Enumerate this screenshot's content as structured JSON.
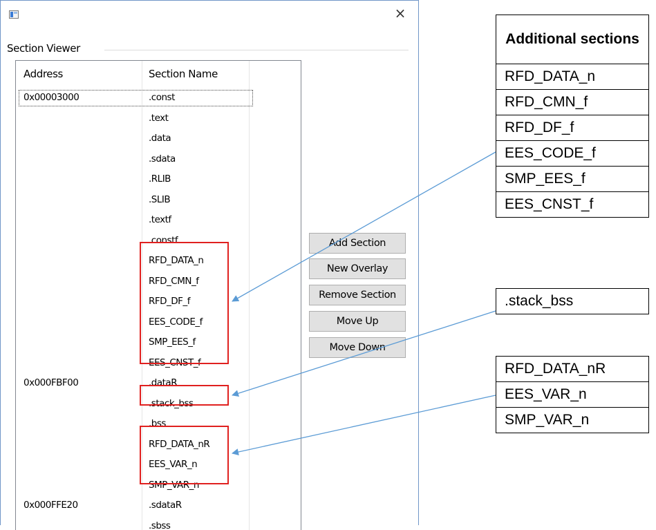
{
  "window": {
    "close_glyph": "×",
    "group_label": "Section Viewer"
  },
  "list": {
    "columns": [
      "Address",
      "Section Name"
    ],
    "rows": [
      {
        "address": "0x00003000",
        "name": ".const"
      },
      {
        "address": "",
        "name": ".text"
      },
      {
        "address": "",
        "name": ".data"
      },
      {
        "address": "",
        "name": ".sdata"
      },
      {
        "address": "",
        "name": ".RLIB"
      },
      {
        "address": "",
        "name": ".SLIB"
      },
      {
        "address": "",
        "name": ".textf"
      },
      {
        "address": "",
        "name": ".constf"
      },
      {
        "address": "",
        "name": "RFD_DATA_n"
      },
      {
        "address": "",
        "name": "RFD_CMN_f"
      },
      {
        "address": "",
        "name": "RFD_DF_f"
      },
      {
        "address": "",
        "name": "EES_CODE_f"
      },
      {
        "address": "",
        "name": "SMP_EES_f"
      },
      {
        "address": "",
        "name": "EES_CNST_f"
      },
      {
        "address": "0x000FBF00",
        "name": ".dataR"
      },
      {
        "address": "",
        "name": ".stack_bss"
      },
      {
        "address": "",
        "name": ".bss"
      },
      {
        "address": "",
        "name": "RFD_DATA_nR"
      },
      {
        "address": "",
        "name": "EES_VAR_n"
      },
      {
        "address": "",
        "name": "SMP_VAR_n"
      },
      {
        "address": "0x000FFE20",
        "name": ".sdataR"
      },
      {
        "address": "",
        "name": ".sbss"
      }
    ]
  },
  "buttons": {
    "add_section": "Add Section",
    "new_overlay": "New Overlay",
    "remove_section": "Remove Section",
    "move_up": "Move Up",
    "move_down": "Move Down"
  },
  "annotations": {
    "additional_title": "Additional sections",
    "additional": [
      "RFD_DATA_n",
      "RFD_CMN_f",
      "RFD_DF_f",
      "EES_CODE_f",
      "SMP_EES_f",
      "EES_CNST_f"
    ],
    "stack": ".stack_bss",
    "ram": [
      "RFD_DATA_nR",
      "EES_VAR_n",
      "SMP_VAR_n"
    ]
  },
  "colors": {
    "highlight_box": "#e0201f",
    "arrow": "#5b9bd5"
  }
}
